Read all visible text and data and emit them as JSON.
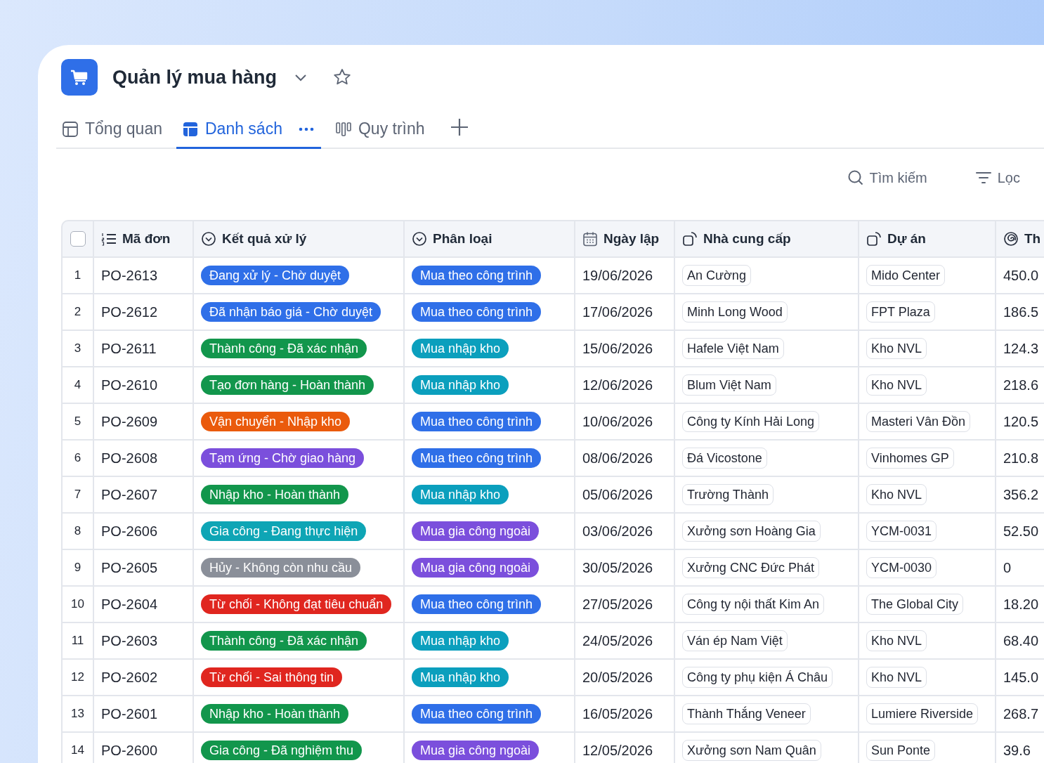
{
  "app": {
    "title": "Quản lý mua hàng"
  },
  "tabs": [
    {
      "label": "Tổng quan",
      "kind": "overview",
      "selected": false
    },
    {
      "label": "Danh sách",
      "kind": "list",
      "selected": true
    },
    {
      "label": "Quy trình",
      "kind": "board",
      "selected": false
    }
  ],
  "toolbar": [
    {
      "label": "Tìm kiếm",
      "kind": "search"
    },
    {
      "label": "Lọc",
      "kind": "filter"
    }
  ],
  "table": {
    "select_all": {
      "checked": false
    },
    "columns": [
      {
        "label": "Mã đơn",
        "kind": "number"
      },
      {
        "label": "Kết quả xử lý",
        "kind": "select"
      },
      {
        "label": "Phân loại",
        "kind": "select"
      },
      {
        "label": "Ngày lập",
        "kind": "date"
      },
      {
        "label": "Nhà cung cấp",
        "kind": "link"
      },
      {
        "label": "Dự án",
        "kind": "link"
      },
      {
        "label": "Th",
        "kind": "formula"
      }
    ],
    "rows": [
      {
        "index": "1",
        "code": "PO-2613",
        "result": {
          "text": "Đang xử lý - Chờ duyệt",
          "color": "#2f6fe8"
        },
        "category": {
          "text": "Mua theo công trình",
          "color": "#2f6fe8"
        },
        "date": "19/06/2026",
        "supplier": "An Cường",
        "project": "Mido Center",
        "column_7": "450.0"
      },
      {
        "index": "2",
        "code": "PO-2612",
        "result": {
          "text": "Đã nhận báo giá - Chờ duyệt",
          "color": "#2f6fe8"
        },
        "category": {
          "text": "Mua theo công trình",
          "color": "#2f6fe8"
        },
        "date": "17/06/2026",
        "supplier": "Minh Long Wood",
        "project": "FPT Plaza",
        "column_7": "186.5"
      },
      {
        "index": "3",
        "code": "PO-2611",
        "result": {
          "text": "Thành công - Đã xác nhận",
          "color": "#12964c"
        },
        "category": {
          "text": "Mua nhập kho",
          "color": "#0b9fbd"
        },
        "date": "15/06/2026",
        "supplier": "Hafele Việt Nam",
        "project": "Kho NVL",
        "column_7": "124.3"
      },
      {
        "index": "4",
        "code": "PO-2610",
        "result": {
          "text": "Tạo đơn hàng - Hoàn thành",
          "color": "#12964c"
        },
        "category": {
          "text": "Mua nhập kho",
          "color": "#0b9fbd"
        },
        "date": "12/06/2026",
        "supplier": "Blum Việt Nam",
        "project": "Kho NVL",
        "column_7": "218.6"
      },
      {
        "index": "5",
        "code": "PO-2609",
        "result": {
          "text": "Vận chuyển - Nhập kho",
          "color": "#ea5a0c"
        },
        "category": {
          "text": "Mua theo công trình",
          "color": "#2f6fe8"
        },
        "date": "10/06/2026",
        "supplier": "Công ty Kính Hải Long",
        "project": "Masteri Vân Đồn",
        "column_7": "120.5"
      },
      {
        "index": "6",
        "code": "PO-2608",
        "result": {
          "text": "Tạm ứng - Chờ giao hàng",
          "color": "#7b4fdc"
        },
        "category": {
          "text": "Mua theo công trình",
          "color": "#2f6fe8"
        },
        "date": "08/06/2026",
        "supplier": "Đá Vicostone",
        "project": "Vinhomes GP",
        "column_7": "210.8"
      },
      {
        "index": "7",
        "code": "PO-2607",
        "result": {
          "text": "Nhập kho - Hoàn thành",
          "color": "#12964c"
        },
        "category": {
          "text": "Mua nhập kho",
          "color": "#0b9fbd"
        },
        "date": "05/06/2026",
        "supplier": "Trường Thành",
        "project": "Kho NVL",
        "column_7": "356.2"
      },
      {
        "index": "8",
        "code": "PO-2606",
        "result": {
          "text": "Gia công - Đang thực hiện",
          "color": "#0ea5b5"
        },
        "category": {
          "text": "Mua gia công ngoài",
          "color": "#7b4fdc"
        },
        "date": "03/06/2026",
        "supplier": "Xưởng sơn Hoàng Gia",
        "project": "YCM-0031",
        "column_7": "52.50"
      },
      {
        "index": "9",
        "code": "PO-2605",
        "result": {
          "text": "Hủy - Không còn nhu cầu",
          "color": "#8a8f99"
        },
        "category": {
          "text": "Mua gia công ngoài",
          "color": "#7b4fdc"
        },
        "date": "30/05/2026",
        "supplier": "Xưởng CNC Đức Phát",
        "project": "YCM-0030",
        "column_7": "0"
      },
      {
        "index": "10",
        "code": "PO-2604",
        "result": {
          "text": "Từ chối - Không đạt tiêu chuẩn",
          "color": "#e0261f"
        },
        "category": {
          "text": "Mua theo công trình",
          "color": "#2f6fe8"
        },
        "date": "27/05/2026",
        "supplier": "Công ty nội thất Kim An",
        "project": "The Global City",
        "column_7": "18.20"
      },
      {
        "index": "11",
        "code": "PO-2603",
        "result": {
          "text": "Thành công - Đã xác nhận",
          "color": "#12964c"
        },
        "category": {
          "text": "Mua nhập kho",
          "color": "#0b9fbd"
        },
        "date": "24/05/2026",
        "supplier": "Ván ép Nam Việt",
        "project": "Kho NVL",
        "column_7": "68.40"
      },
      {
        "index": "12",
        "code": "PO-2602",
        "result": {
          "text": "Từ chối - Sai thông tin",
          "color": "#e0261f"
        },
        "category": {
          "text": "Mua nhập kho",
          "color": "#0b9fbd"
        },
        "date": "20/05/2026",
        "supplier": "Công ty phụ kiện Á Châu",
        "project": "Kho NVL",
        "column_7": "145.0"
      },
      {
        "index": "13",
        "code": "PO-2601",
        "result": {
          "text": "Nhập kho - Hoàn thành",
          "color": "#12964c"
        },
        "category": {
          "text": "Mua theo công trình",
          "color": "#2f6fe8"
        },
        "date": "16/05/2026",
        "supplier": "Thành Thắng Veneer",
        "project": "Lumiere Riverside",
        "column_7": "268.7"
      },
      {
        "index": "14",
        "code": "PO-2600",
        "result": {
          "text": "Gia công - Đã nghiệm thu",
          "color": "#12964c"
        },
        "category": {
          "text": "Mua gia công ngoài",
          "color": "#7b4fdc"
        },
        "date": "12/05/2026",
        "supplier": "Xưởng sơn Nam Quân",
        "project": "Sun Ponte",
        "column_7": "39.6"
      }
    ]
  }
}
